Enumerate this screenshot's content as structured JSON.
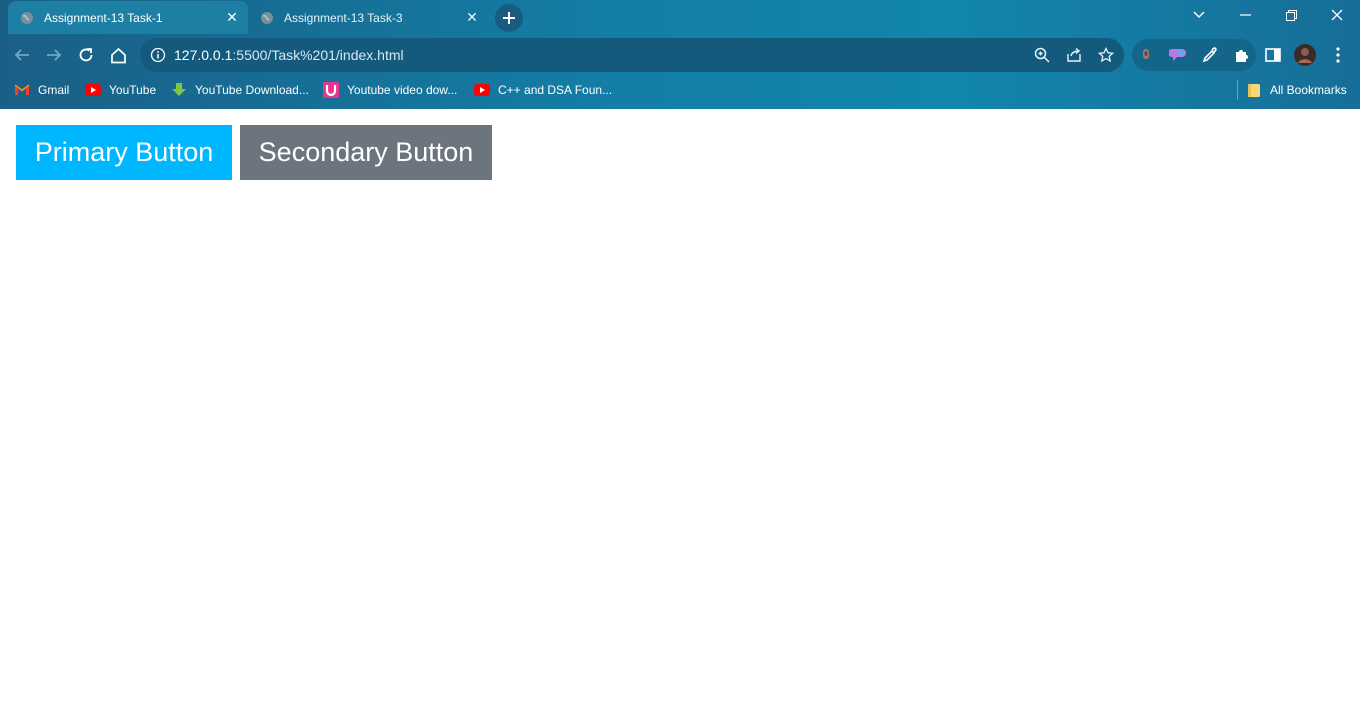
{
  "browser": {
    "tabs": [
      {
        "title": "Assignment-13 Task-1",
        "active": true
      },
      {
        "title": "Assignment-13 Task-3",
        "active": false
      }
    ],
    "url": {
      "host": "127.0.0.1",
      "path": ":5500/Task%201/index.html"
    },
    "bookmarks": [
      {
        "label": "Gmail",
        "icon": "gmail-icon"
      },
      {
        "label": "YouTube",
        "icon": "youtube-icon"
      },
      {
        "label": "YouTube Download...",
        "icon": "download-icon"
      },
      {
        "label": "Youtube video dow...",
        "icon": "u-icon"
      },
      {
        "label": "C++ and DSA Foun...",
        "icon": "youtube-icon"
      }
    ],
    "all_bookmarks_label": "All Bookmarks"
  },
  "page": {
    "primary_button": {
      "label": "Primary Button",
      "color": "#00b7ff"
    },
    "secondary_button": {
      "label": "Secondary Button",
      "color": "#6c757d"
    }
  }
}
